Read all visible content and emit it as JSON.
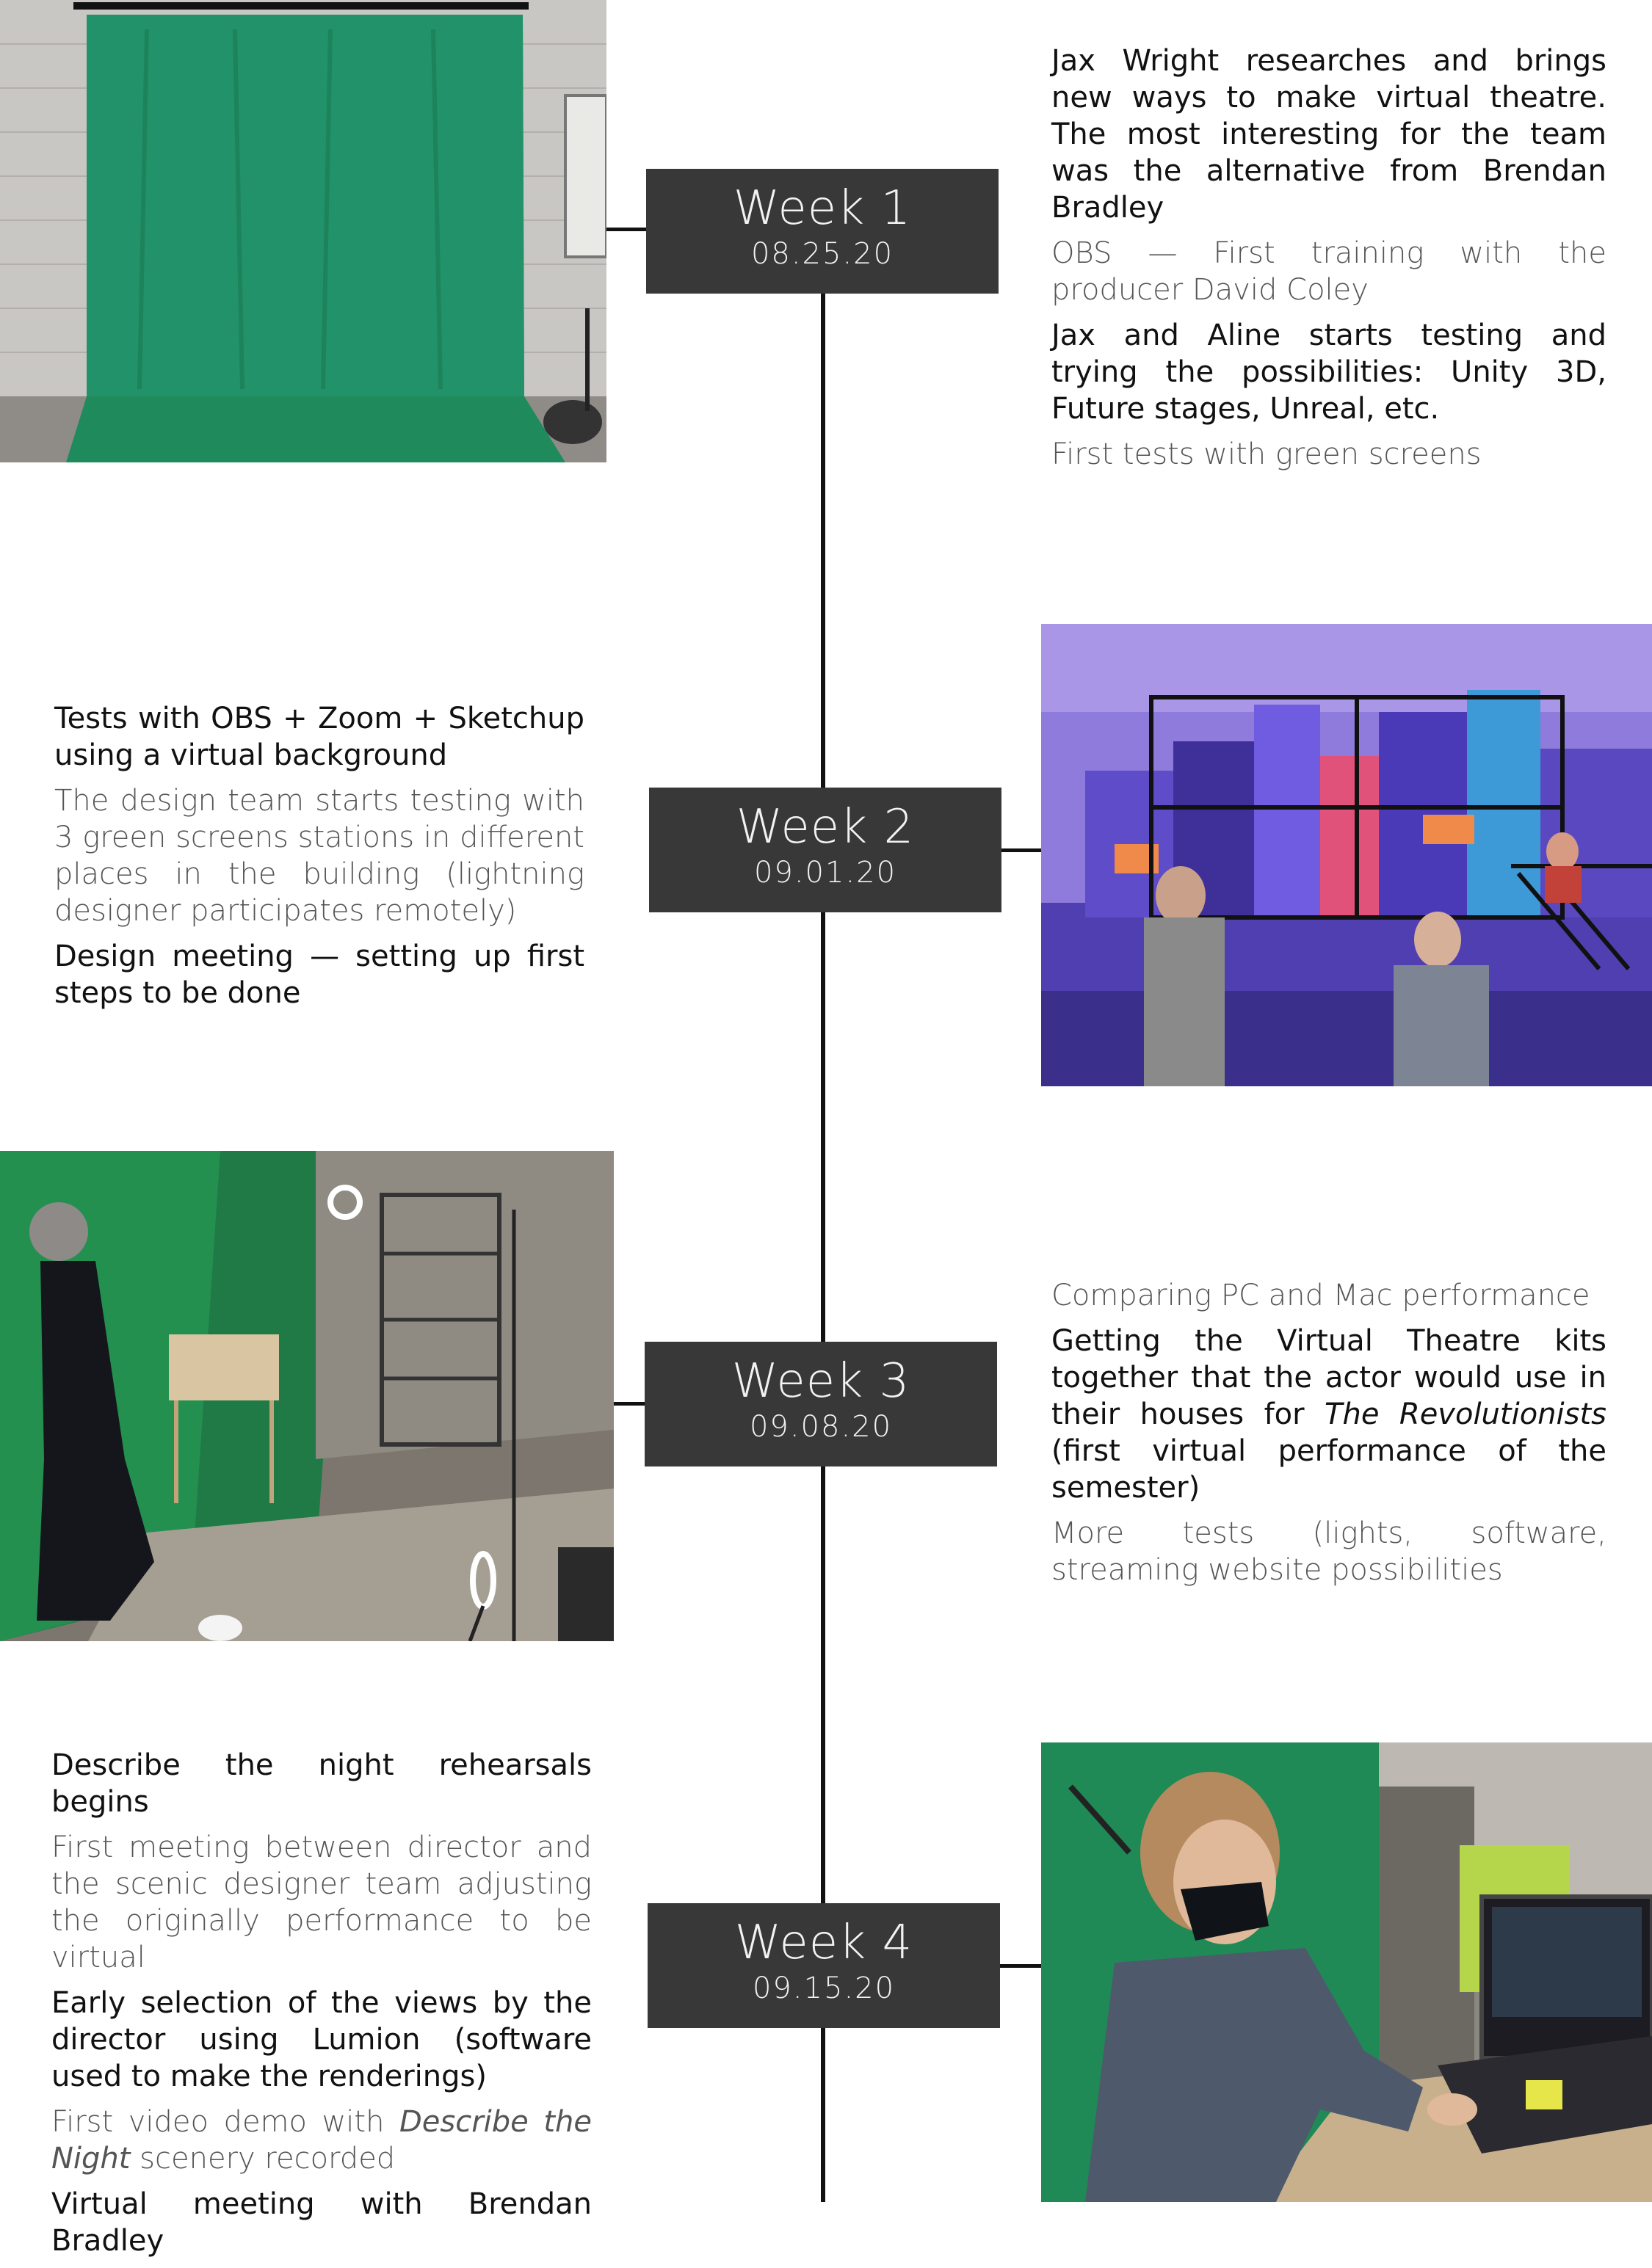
{
  "weeks": [
    {
      "title": "Week 1",
      "date": "08.25.20",
      "notes": [
        {
          "text": "Jax Wright researches and brings new ways to make virtual theatre. The most interesting for the team was the alternative from Brendan Bradley",
          "style": "dark"
        },
        {
          "text": "OBS — First training with the producer David Coley",
          "style": "light"
        },
        {
          "text": "Jax and Aline starts testing and trying the possibilities: Unity 3D, Future stages, Unreal, etc.",
          "style": "dark"
        },
        {
          "text": "First tests with green screens",
          "style": "light"
        }
      ]
    },
    {
      "title": "Week 2",
      "date": "09.01.20",
      "notes": [
        {
          "text": "Tests with OBS + Zoom + Sketchup using a virtual background",
          "style": "dark"
        },
        {
          "text": "The design team starts testing with 3 green screens stations in different places in the building (lightning designer participates remotely)",
          "style": "light"
        },
        {
          "text": "Design meeting — setting up first steps to be done",
          "style": "dark"
        }
      ]
    },
    {
      "title": "Week 3",
      "date": "09.08.20",
      "notes": [
        {
          "text": "Comparing PC and Mac performance",
          "style": "light"
        },
        {
          "before": "Getting the Virtual Theatre kits together that the actor would use in their houses for ",
          "italic": "The Revolutionists",
          "after": " (first virtual performance of the semester)",
          "style": "dark"
        },
        {
          "text": "More tests (lights, software, streaming website possibilities",
          "style": "light"
        }
      ]
    },
    {
      "title": "Week 4",
      "date": "09.15.20",
      "notes": [
        {
          "text": "Describe the night rehearsals begins",
          "style": "dark"
        },
        {
          "text": "First meeting between director and the scenic designer team adjusting the originally performance to be virtual",
          "style": "light"
        },
        {
          "text": "Early selection of the views by the director using Lumion (software used to make the renderings)",
          "style": "dark"
        },
        {
          "before": "First video demo with ",
          "italic": "Describe the Night",
          "after": " scenery recorded",
          "style": "light"
        },
        {
          "text": "Virtual meeting with Brendan Bradley",
          "style": "dark"
        }
      ]
    }
  ],
  "colors": {
    "week_box": "#383838",
    "week_text": "#f2f2f2",
    "line": "#111111",
    "chroma_green": "#1f8a5c",
    "set_purple": "#7a5fd6"
  },
  "icons": [
    "green-screen-photo",
    "virtual-set-render",
    "green-screen-studio-photo",
    "actor-at-laptop-photo"
  ]
}
